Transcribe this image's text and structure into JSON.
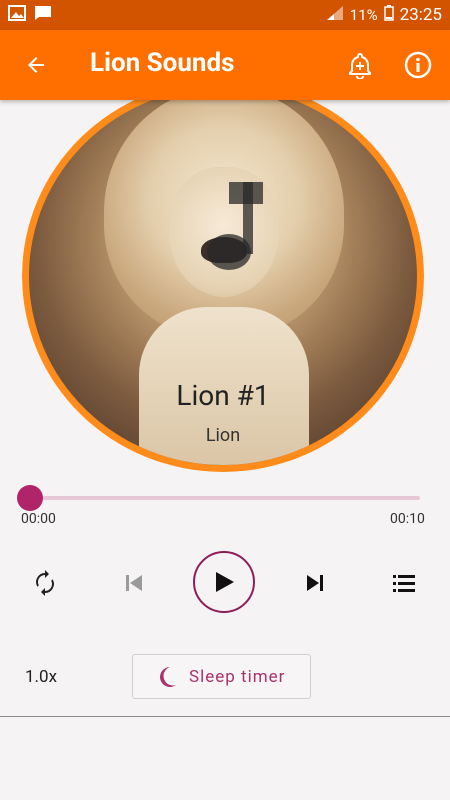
{
  "status_bar": {
    "battery_percent": "11%",
    "time": "23:25",
    "icons": [
      "image-icon",
      "message-icon",
      "signal-icon",
      "battery-icon"
    ]
  },
  "app_bar": {
    "title": "Lion Sounds",
    "back_icon": "arrow-left-icon",
    "alarm_icon": "alarm-add-icon",
    "info_icon": "info-icon",
    "color": "#ff6f00"
  },
  "track": {
    "title": "Lion #1",
    "artist": "Lion"
  },
  "player": {
    "elapsed": "00:00",
    "duration": "00:10",
    "progress": 0.0,
    "accent_color": "#b0256a"
  },
  "controls": {
    "repeat_icon": "repeat-icon",
    "previous_icon": "skip-previous-icon",
    "play_icon": "play-icon",
    "next_icon": "skip-next-icon",
    "playlist_icon": "playlist-icon"
  },
  "bottom": {
    "speed": "1.0x",
    "sleep_timer_label": "Sleep timer",
    "sleep_icon": "moon-icon"
  }
}
